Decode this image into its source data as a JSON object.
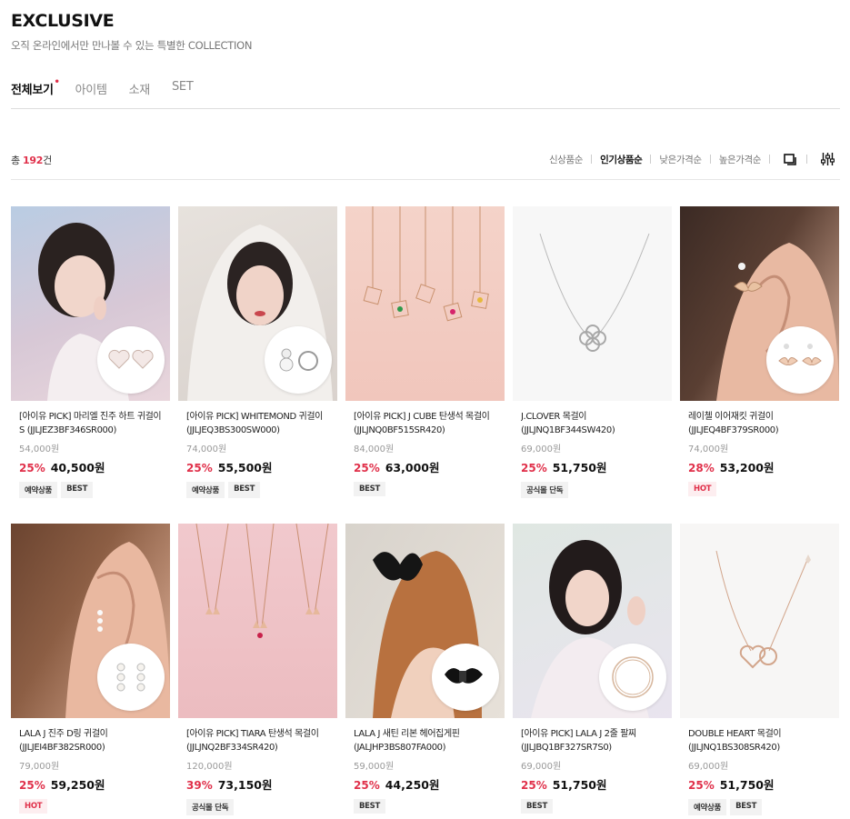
{
  "header": {
    "title": "EXCLUSIVE",
    "subtitle": "오직 온라인에서만 만나볼 수 있는 특별한 COLLECTION"
  },
  "tabs": [
    {
      "label": "전체보기",
      "active": true
    },
    {
      "label": "아이템",
      "active": false
    },
    {
      "label": "소재",
      "active": false
    },
    {
      "label": "SET",
      "active": false
    }
  ],
  "tab_dot": "•",
  "count": {
    "prefix": "총 ",
    "number": "192",
    "suffix": "건"
  },
  "sort_options": [
    {
      "label": "신상품순",
      "active": false
    },
    {
      "label": "인기상품순",
      "active": true
    },
    {
      "label": "낮은가격순",
      "active": false
    },
    {
      "label": "높은가격순",
      "active": false
    }
  ],
  "tools": [
    "view-toggle-icon",
    "filter-sliders-icon"
  ],
  "products": [
    {
      "name": "[아이유 PICK] 마리엘 진주 하트 귀걸이 S (JJLJEZ3BF346SR000)",
      "original_price": "54,000원",
      "discount": "25%",
      "price": "40,500원",
      "badges": [
        "예약상품",
        "BEST"
      ]
    },
    {
      "name": "[아이유 PICK] WHITEMOND 귀걸이 (JJLJEQ3BS300SW000)",
      "original_price": "74,000원",
      "discount": "25%",
      "price": "55,500원",
      "badges": [
        "예약상품",
        "BEST"
      ]
    },
    {
      "name": "[아이유 PICK] J CUBE 탄생석 목걸이 (JJLJNQ0BF515SR420)",
      "original_price": "84,000원",
      "discount": "25%",
      "price": "63,000원",
      "badges": [
        "BEST"
      ]
    },
    {
      "name": "J.CLOVER 목걸이 (JJLJNQ1BF344SW420)",
      "original_price": "69,000원",
      "discount": "25%",
      "price": "51,750원",
      "badges": [
        "공식몰 단독"
      ]
    },
    {
      "name": "레이첼 이어재킷 귀걸이 (JJLJEQ4BF379SR000)",
      "original_price": "74,000원",
      "discount": "28%",
      "price": "53,200원",
      "badges": [
        "HOT"
      ]
    },
    {
      "name": "LALA J 진주 D링 귀걸이 (JJLJEI4BF382SR000)",
      "original_price": "79,000원",
      "discount": "25%",
      "price": "59,250원",
      "badges": [
        "HOT"
      ]
    },
    {
      "name": "[아이유 PICK] TIARA 탄생석 목걸이 (JJLJNQ2BF334SR420)",
      "original_price": "120,000원",
      "discount": "39%",
      "price": "73,150원",
      "badges": [
        "공식몰 단독"
      ]
    },
    {
      "name": "LALA J 새틴 리본 헤어집게핀 (JALJHP3BS807FA000)",
      "original_price": "59,000원",
      "discount": "25%",
      "price": "44,250원",
      "badges": [
        "BEST"
      ]
    },
    {
      "name": "[아이유 PICK] LALA J 2줄 팔찌 (JJLJBQ1BF327SR7S0)",
      "original_price": "69,000원",
      "discount": "25%",
      "price": "51,750원",
      "badges": [
        "BEST"
      ]
    },
    {
      "name": "DOUBLE HEART 목걸이 (JJLJNQ1BS308SR420)",
      "original_price": "69,000원",
      "discount": "25%",
      "price": "51,750원",
      "badges": [
        "예약상품",
        "BEST"
      ]
    }
  ]
}
